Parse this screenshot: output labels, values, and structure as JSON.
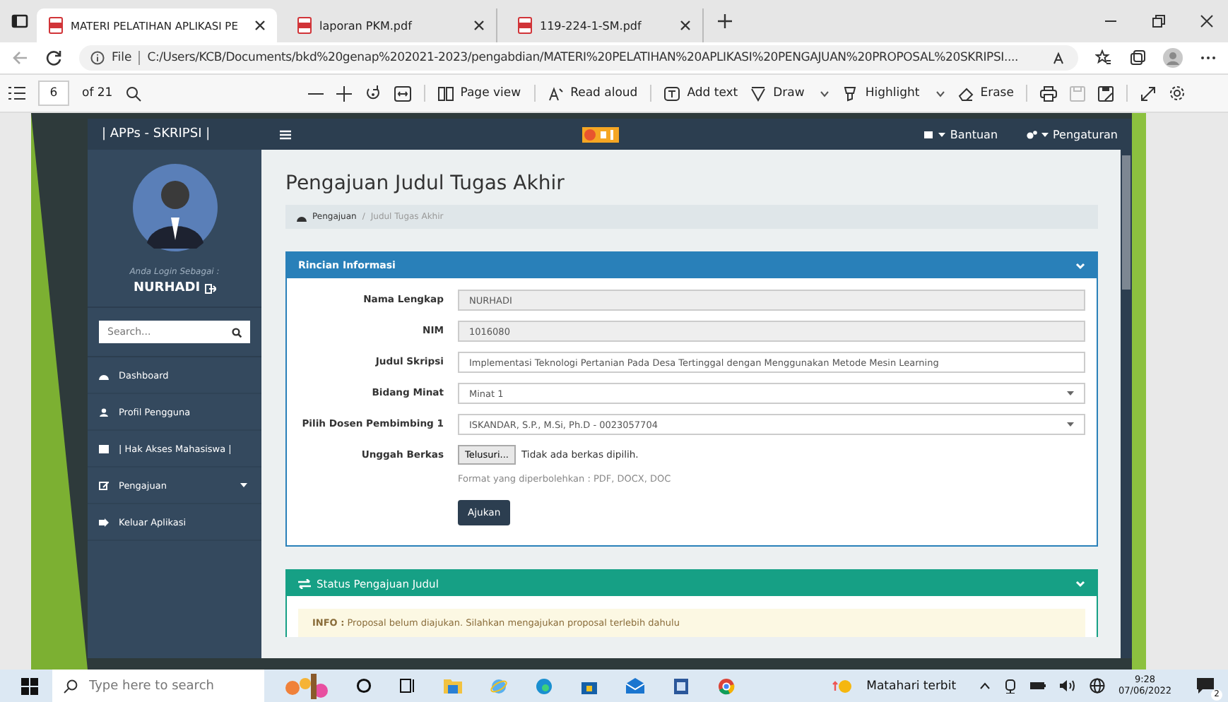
{
  "browser": {
    "tabs": [
      {
        "title": "MATERI PELATIHAN APLIKASI PE",
        "selected": true
      },
      {
        "title": "laporan PKM.pdf",
        "selected": false
      },
      {
        "title": "119-224-1-SM.pdf",
        "selected": false
      }
    ],
    "address": {
      "scheme": "File",
      "url": "C:/Users/KCB/Documents/bkd%20genap%202021-2023/pengabdian/MATERI%20PELATIHAN%20APLIKASI%20PENGAJUAN%20PROPOSAL%20SKRIPSI...."
    }
  },
  "pdf_toolbar": {
    "page": "6",
    "page_count": "of 21",
    "tools": [
      {
        "label": "Page view",
        "dropdown": false
      },
      {
        "label": "Read aloud",
        "dropdown": false
      },
      {
        "label": "Add text",
        "dropdown": false
      },
      {
        "label": "Draw",
        "dropdown": true
      },
      {
        "label": "Highlight",
        "dropdown": true
      },
      {
        "label": "Erase",
        "dropdown": false
      }
    ]
  },
  "app": {
    "brand": "| APPs - SKRIPSI |",
    "nav": [
      "Bantuan",
      "Pengaturan"
    ],
    "login_caption": "Anda Login Sebagai :",
    "user": "NURHADI",
    "search": {
      "placeholder": "Search..."
    },
    "sidebar": {
      "items": [
        {
          "label": "Dashboard",
          "has_submenu": false
        },
        {
          "label": "Profil Pengguna",
          "has_submenu": false
        },
        {
          "label": "| Hak Akses Mahasiswa |",
          "has_submenu": false
        },
        {
          "label": "Pengajuan",
          "has_submenu": true
        },
        {
          "label": "Keluar Aplikasi",
          "has_submenu": false
        }
      ]
    },
    "page_title": "Pengajuan Judul Tugas Akhir",
    "breadcrumb": [
      "Pengajuan",
      "Judul Tugas Akhir"
    ],
    "breadcrumb_separator": "/",
    "form_panel": {
      "title": "Rincian Informasi",
      "fields": [
        {
          "label": "Nama Lengkap",
          "kind": "readonly",
          "value": "NURHADI"
        },
        {
          "label": "NIM",
          "kind": "readonly",
          "value": "1016080"
        },
        {
          "label": "Judul Skripsi",
          "kind": "text",
          "value": "Implementasi Teknologi Pertanian Pada Desa Tertinggal dengan Menggunakan Metode Mesin Learning"
        },
        {
          "label": "Bidang Minat",
          "kind": "select",
          "value": "Minat 1"
        },
        {
          "label": "Pilih Dosen Pembimbing 1",
          "kind": "select",
          "value": "ISKANDAR, S.P., M.Si, Ph.D - 0023057704"
        },
        {
          "label": "Unggah Berkas",
          "kind": "file",
          "button": "Telusuri...",
          "value": "Tidak ada berkas dipilih.",
          "hint": "Format yang diperbolehkan : PDF, DOCX, DOC"
        }
      ],
      "submit": "Ajukan"
    },
    "status_panel": {
      "title": "Status Pengajuan Judul",
      "info": "**INFO :** Proposal belum diajukan. Silahkan mengajukan proposal terlebih dahulu"
    }
  },
  "taskbar": {
    "search": {
      "placeholder": "Type here to search"
    },
    "weather": "Matahari terbit",
    "time": "9:28",
    "date": "07/06/2022",
    "notifications": "2"
  }
}
